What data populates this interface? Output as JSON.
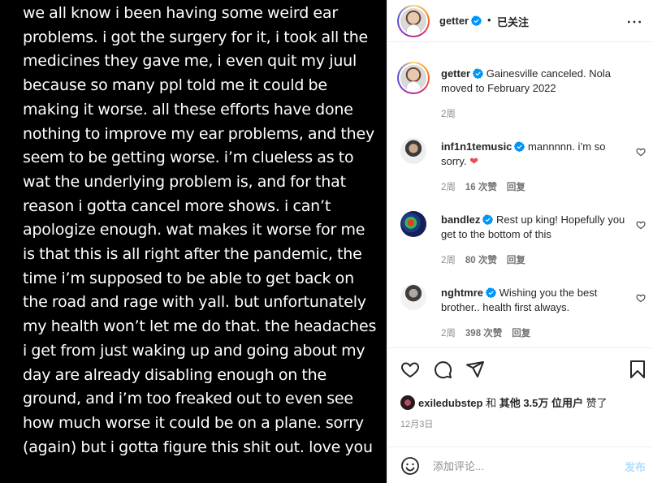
{
  "post": {
    "text": "we all know i been having some weird ear problems. i got the surgery for it, i took all the medicines they gave me, i even quit my juul because so many ppl told me it could be making it worse. all these efforts have done nothing to improve my ear problems, and they seem to be getting worse. i’m clueless as to wat the underlying problem is, and for that reason i gotta cancel more shows. i can’t apologize enough. wat makes it worse for me is that this is all right after the pandemic, the time i’m supposed to be able to get back on the road and rage with yall. but unfortunately my health won’t let me do that. the headaches i get from just waking up and going about my day are already disabling enough on the ground, and i’m too freaked out to even see how much worse it could be on a plane. sorry (again) but i gotta figure this shit out. love you"
  },
  "header": {
    "username": "getter",
    "dot": "•",
    "follow_status": "已关注",
    "more_icon": "more-horizontal-icon"
  },
  "caption": {
    "username": "getter",
    "text": "Gainesville canceled. Nola moved to February 2022",
    "time": "2周"
  },
  "comments": [
    {
      "username": "inf1n1temusic",
      "text": "mannnnn. i’m so sorry. ",
      "emoji": "❤",
      "time": "2周",
      "likes": "16 次赞",
      "reply": "回复"
    },
    {
      "username": "bandlez",
      "text": "Rest up king! Hopefully you get to the bottom of this",
      "time": "2周",
      "likes": "80 次赞",
      "reply": "回复"
    },
    {
      "username": "nghtmre",
      "text": "Wishing you the best brother.. health first always.",
      "time": "2周",
      "likes": "398 次赞",
      "reply": "回复"
    }
  ],
  "actions": {
    "like_icon": "heart-icon",
    "comment_icon": "comment-icon",
    "share_icon": "send-icon",
    "save_icon": "bookmark-icon"
  },
  "likes": {
    "user": "exiledubstep",
    "and": " 和 ",
    "others": "其他 3.5万 位用户",
    "suffix": " 赞了"
  },
  "date": "12月3日",
  "add_comment": {
    "placeholder": "添加评论...",
    "post_label": "发布"
  },
  "colors": {
    "verified": "#0095f6",
    "post_button_disabled": "#b2dffc",
    "secondary_text": "#8e8e8e",
    "heart_red": "#ed4956"
  }
}
